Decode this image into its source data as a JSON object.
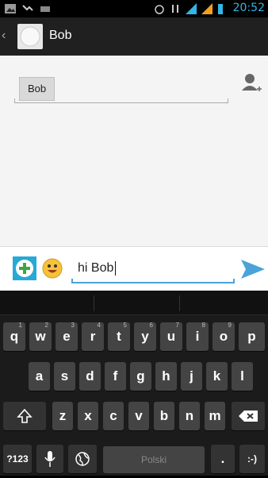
{
  "status_bar": {
    "time": "20:52"
  },
  "action_bar": {
    "back": "‹",
    "title": "Bob"
  },
  "recipients": {
    "chip": "Bob"
  },
  "compose": {
    "text": "hi Bob"
  },
  "keyboard": {
    "row1": [
      {
        "label": "q",
        "hint": "1"
      },
      {
        "label": "w",
        "hint": "2"
      },
      {
        "label": "e",
        "hint": "3"
      },
      {
        "label": "r",
        "hint": "4"
      },
      {
        "label": "t",
        "hint": "5"
      },
      {
        "label": "y",
        "hint": "6"
      },
      {
        "label": "u",
        "hint": "7"
      },
      {
        "label": "i",
        "hint": "8"
      },
      {
        "label": "o",
        "hint": "9"
      },
      {
        "label": "p",
        "hint": ""
      }
    ],
    "row2": [
      "a",
      "s",
      "d",
      "f",
      "g",
      "h",
      "j",
      "k",
      "l"
    ],
    "row3": [
      "z",
      "x",
      "c",
      "v",
      "b",
      "n",
      "m"
    ],
    "symbols_label": "?123",
    "space_label": "Polski",
    "period_label": ".",
    "smiley_label": ":-)"
  }
}
